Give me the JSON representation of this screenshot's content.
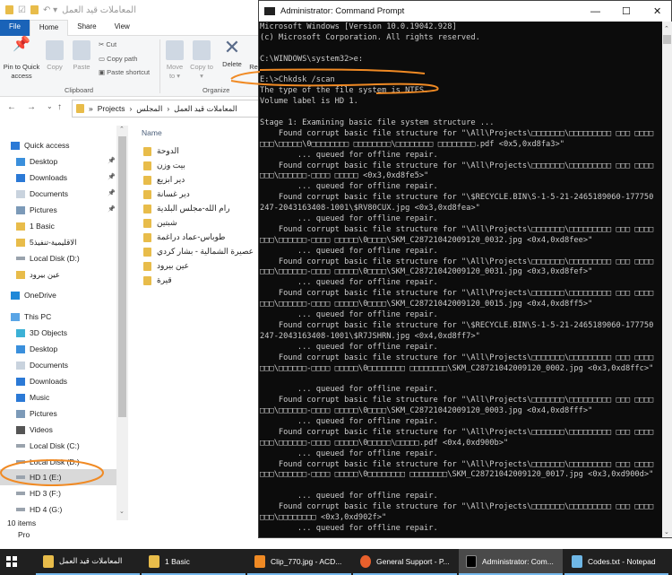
{
  "explorer": {
    "title": "المعاملات قيد العمل",
    "tabs": [
      "File",
      "Home",
      "Share",
      "View"
    ],
    "ribbon": {
      "pin": "Pin to Quick access",
      "copy": "Copy",
      "paste": "Paste",
      "cut": "Cut",
      "copy_path": "Copy path",
      "paste_shortcut": "Paste shortcut",
      "clipboard": "Clipboard",
      "move_to": "Move to",
      "copy_to": "Copy to",
      "delete": "Delete",
      "rename": "Re",
      "organize": "Organize"
    },
    "breadcrumb": [
      "Projects",
      "المجلس",
      "المعاملات قيد العمل"
    ],
    "nav": [
      {
        "label": "Quick access",
        "icon": "star-icon"
      },
      {
        "label": "Desktop",
        "icon": "desktop-icon",
        "pinned": true
      },
      {
        "label": "Downloads",
        "icon": "download-icon",
        "pinned": true
      },
      {
        "label": "Documents",
        "icon": "document-icon",
        "pinned": true
      },
      {
        "label": "Pictures",
        "icon": "pictures-icon",
        "pinned": true
      },
      {
        "label": "1 Basic",
        "icon": "folder-icon"
      },
      {
        "label": "5الاقليمية-تنفيذ",
        "icon": "folder-icon"
      },
      {
        "label": "Local Disk (D:)",
        "icon": "drive-icon"
      },
      {
        "label": "عين بيرود",
        "icon": "folder-icon"
      },
      {
        "label": "OneDrive",
        "icon": "cloud-icon"
      },
      {
        "label": "This PC",
        "icon": "computer-icon"
      },
      {
        "label": "3D Objects",
        "icon": "cube-icon"
      },
      {
        "label": "Desktop",
        "icon": "desktop-icon"
      },
      {
        "label": "Documents",
        "icon": "document-icon"
      },
      {
        "label": "Downloads",
        "icon": "download-icon"
      },
      {
        "label": "Music",
        "icon": "music-icon"
      },
      {
        "label": "Pictures",
        "icon": "pictures-icon"
      },
      {
        "label": "Videos",
        "icon": "video-icon"
      },
      {
        "label": "Local Disk (C:)",
        "icon": "drive-icon"
      },
      {
        "label": "Local Disk (D:)",
        "icon": "drive-icon"
      },
      {
        "label": "HD 1 (E:)",
        "icon": "drive-icon",
        "selected": true
      },
      {
        "label": "HD 3 (F:)",
        "icon": "drive-icon"
      },
      {
        "label": "HD 4 (G:)",
        "icon": "drive-icon"
      }
    ],
    "column_name": "Name",
    "files": [
      "الدوحة",
      "بيت وزن",
      "دير ابزيع",
      "دير غسانة",
      "رام الله-مجلس البلدية",
      "شبتين",
      "طوباس-عماد دراغمة",
      "عصيرة الشمالية - بشار كردي",
      "عين بيرود",
      "قيرة"
    ],
    "status": "10 items",
    "behind_text": "Pro"
  },
  "cmd": {
    "title": "Administrator: Command Prompt",
    "lines": [
      "Microsoft Windows [Version 10.0.19042.928]",
      "(c) Microsoft Corporation. All rights reserved.",
      "",
      "C:\\WINDOWS\\system32>e:",
      "",
      "E:\\>Chkdsk /scan",
      "The type of the file system is NTFS.",
      "Volume label is HD 1.",
      "",
      "Stage 1: Examining basic file system structure ...",
      "    Found corrupt basic file structure for \"\\All\\Projects\\□□□□□□□\\□□□□□□□□□ □□□ □□□□",
      "□□□\\□□□□□\\0□□□□□□□□ □□□□□□□□\\□□□□□□□□ □□□□□□□□.pdf <0x5,0xd8fa3>\"",
      "        ... queued for offline repair.",
      "    Found corrupt basic file structure for \"\\All\\Projects\\□□□□□□□\\□□□□□□□□□ □□□ □□□□",
      "□□□\\□□□□□□-□□□□ □□□□□ <0x3,0xd8fe5>\"",
      "        ... queued for offline repair.",
      "    Found corrupt basic file structure for \"\\$RECYCLE.BIN\\S-1-5-21-2465189060-177750",
      "247-2043163408-1001\\$RV80CUX.jpg <0x3,0xd8fea>\"",
      "        ... queued for offline repair.",
      "    Found corrupt basic file structure for \"\\All\\Projects\\□□□□□□□\\□□□□□□□□□ □□□ □□□□",
      "□□□\\□□□□□□-□□□□ □□□□□\\0□□□□\\SKM_C28721042009120_0032.jpg <0x4,0xd8fee>\"",
      "        ... queued for offline repair.",
      "    Found corrupt basic file structure for \"\\All\\Projects\\□□□□□□□\\□□□□□□□□□ □□□ □□□□",
      "□□□\\□□□□□□-□□□□ □□□□□\\0□□□□\\SKM_C28721042009120_0031.jpg <0x3,0xd8fef>\"",
      "        ... queued for offline repair.",
      "    Found corrupt basic file structure for \"\\All\\Projects\\□□□□□□□\\□□□□□□□□□ □□□ □□□□",
      "□□□\\□□□□□□-□□□□ □□□□□\\0□□□□\\SKM_C28721042009120_0015.jpg <0x4,0xd8ff5>\"",
      "        ... queued for offline repair.",
      "    Found corrupt basic file structure for \"\\$RECYCLE.BIN\\S-1-5-21-2465189060-177750",
      "247-2043163408-1001\\$R7JSHRN.jpg <0x4,0xd8ff7>\"",
      "        ... queued for offline repair.",
      "    Found corrupt basic file structure for \"\\All\\Projects\\□□□□□□□\\□□□□□□□□□ □□□ □□□□",
      "□□□\\□□□□□□-□□□□ □□□□□\\0□□□□□□□□ □□□□□□□□\\SKM_C28721042009120_0002.jpg <0x3,0xd8ffc>\"",
      "",
      "        ... queued for offline repair.",
      "    Found corrupt basic file structure for \"\\All\\Projects\\□□□□□□□\\□□□□□□□□□ □□□ □□□□",
      "□□□\\□□□□□□-□□□□ □□□□□\\0□□□□\\SKM_C28721042009120_0003.jpg <0x4,0xd8fff>\"",
      "        ... queued for offline repair.",
      "    Found corrupt basic file structure for \"\\All\\Projects\\□□□□□□□\\□□□□□□□□□ □□□ □□□□",
      "□□□\\□□□□□□-□□□□ □□□□□\\0□□□□□\\□□□□□.pdf <0x4,0xd900b>\"",
      "        ... queued for offline repair.",
      "    Found corrupt basic file structure for \"\\All\\Projects\\□□□□□□□\\□□□□□□□□□ □□□ □□□□",
      "□□□\\□□□□□□-□□□□ □□□□□\\0□□□□□□□□ □□□□□□□□\\SKM_C28721042009120_0017.jpg <0x3,0xd900d>\"",
      "",
      "        ... queued for offline repair.",
      "    Found corrupt basic file structure for \"\\All\\Projects\\□□□□□□□\\□□□□□□□□□ □□□ □□□□",
      "□□□\\□□□□□□□□ <0x3,0xd902f>\"",
      "        ... queued for offline repair."
    ]
  },
  "taskbar": [
    {
      "label": "المعاملات قيد العمل",
      "icon": "folder-icon",
      "color": "#e8bc4a"
    },
    {
      "label": "1 Basic",
      "icon": "folder-icon",
      "color": "#e8bc4a"
    },
    {
      "label": "Clip_770.jpg - ACD...",
      "icon": "acdsee-icon",
      "color": "#f08a24"
    },
    {
      "label": "General Support - P...",
      "icon": "firefox-icon",
      "color": "#e8602c"
    },
    {
      "label": "Administrator: Com...",
      "icon": "cmd-icon",
      "color": "#000000",
      "active": true
    },
    {
      "label": "Codes.txt - Notepad",
      "icon": "notepad-icon",
      "color": "#6fb7e6"
    }
  ],
  "colors": {
    "annotation": "#f08a24",
    "file_tab": "#1a63b8",
    "console_bg": "#0c0c0c"
  }
}
